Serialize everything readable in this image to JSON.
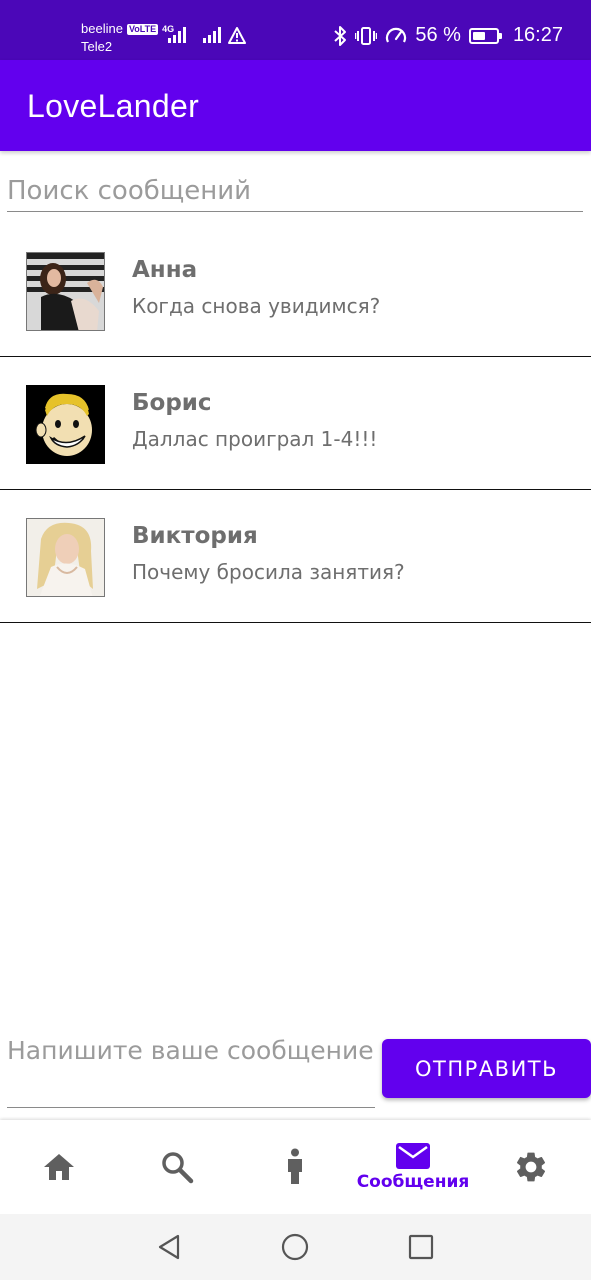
{
  "status_bar": {
    "carrier1": "beeline",
    "volte": "VoLTE",
    "network": "4G",
    "carrier2": "Tele2",
    "battery_text": "56 %",
    "battery_level": 0.56,
    "time": "16:27"
  },
  "app_bar": {
    "title": "LoveLander"
  },
  "search": {
    "placeholder": "Поиск сообщений",
    "value": ""
  },
  "chats": [
    {
      "name": "Анна",
      "message": "Когда снова увидимся?",
      "avatar": "woman-photo"
    },
    {
      "name": "Борис",
      "message": "Даллас проиграл 1-4!!!",
      "avatar": "cartoon-mascot-photo"
    },
    {
      "name": "Виктория",
      "message": "Почему бросила занятия?",
      "avatar": "woman-photo"
    }
  ],
  "composer": {
    "placeholder": "Напишите ваше сообщение",
    "value": ""
  },
  "send_button": {
    "label": "ОТПРАВИТЬ"
  },
  "bottom_nav": {
    "items": [
      {
        "icon": "home-icon",
        "label": ""
      },
      {
        "icon": "search-icon",
        "label": ""
      },
      {
        "icon": "person-icon",
        "label": ""
      },
      {
        "icon": "mail-icon",
        "label": "Сообщения",
        "active": true
      },
      {
        "icon": "gear-icon",
        "label": ""
      }
    ]
  },
  "colors": {
    "status_bar": "#4b07b8",
    "primary": "#6200ee",
    "text_secondary": "#6e6e6e",
    "inactive_icon": "#5f5f5f"
  }
}
